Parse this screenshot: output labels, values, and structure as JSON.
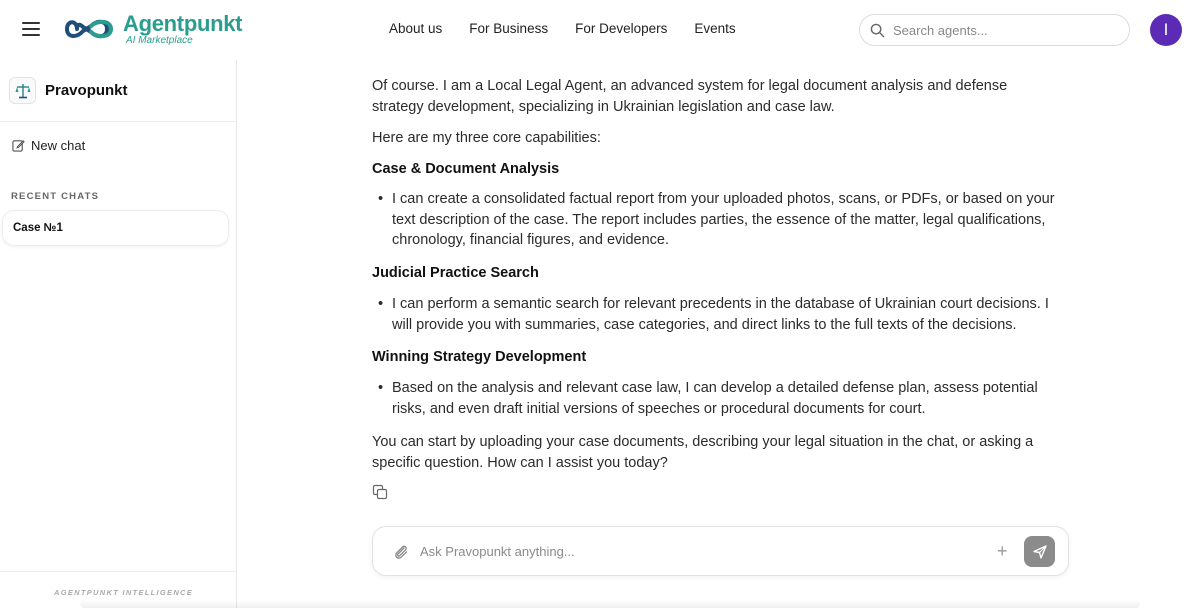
{
  "header": {
    "brand_name": "Agentpunkt",
    "brand_sub": "AI Marketplace",
    "nav": [
      {
        "label": "About us"
      },
      {
        "label": "For Business"
      },
      {
        "label": "For Developers"
      },
      {
        "label": "Events"
      }
    ],
    "search_placeholder": "Search agents...",
    "avatar_letter": "I",
    "avatar_color": "#5b2bb5",
    "brand_color": "#2a9d8f"
  },
  "sidebar": {
    "agent_name": "Pravopunkt",
    "new_chat_label": "New chat",
    "recent_label": "RECENT CHATS",
    "chats": [
      {
        "label": "Case №1"
      }
    ],
    "footer_text": "AGENTPUNKT INTELLIGENCE"
  },
  "message": {
    "intro": "Of course. I am a Local Legal Agent, an advanced system for legal document analysis and defense strategy development, specializing in Ukrainian legislation and case law.",
    "lead": "Here are my three core capabilities:",
    "sections": [
      {
        "heading": "Case & Document Analysis",
        "bullet": "I can create a consolidated factual report from your uploaded photos, scans, or PDFs, or based on your text description of the case. The report includes parties, the essence of the matter, legal qualifications, chronology, financial figures, and evidence."
      },
      {
        "heading": "Judicial Practice Search",
        "bullet": "I can perform a semantic search for relevant precedents in the database of Ukrainian court decisions. I will provide you with summaries, case categories, and direct links to the full texts of the decisions."
      },
      {
        "heading": "Winning Strategy Development",
        "bullet": "Based on the analysis and relevant case law, I can develop a detailed defense plan, assess potential risks, and even draft initial versions of speeches or procedural documents for court."
      }
    ],
    "closing": "You can start by uploading your case documents, describing your legal situation in the chat, or asking a specific question. How can I assist you today?"
  },
  "composer": {
    "placeholder": "Ask Pravopunkt anything..."
  },
  "icons": {
    "menu": "hamburger-icon",
    "search": "search-icon",
    "new_chat": "edit-icon",
    "copy": "copy-icon",
    "attach": "paperclip-icon",
    "plus": "plus-icon",
    "send": "send-icon"
  }
}
